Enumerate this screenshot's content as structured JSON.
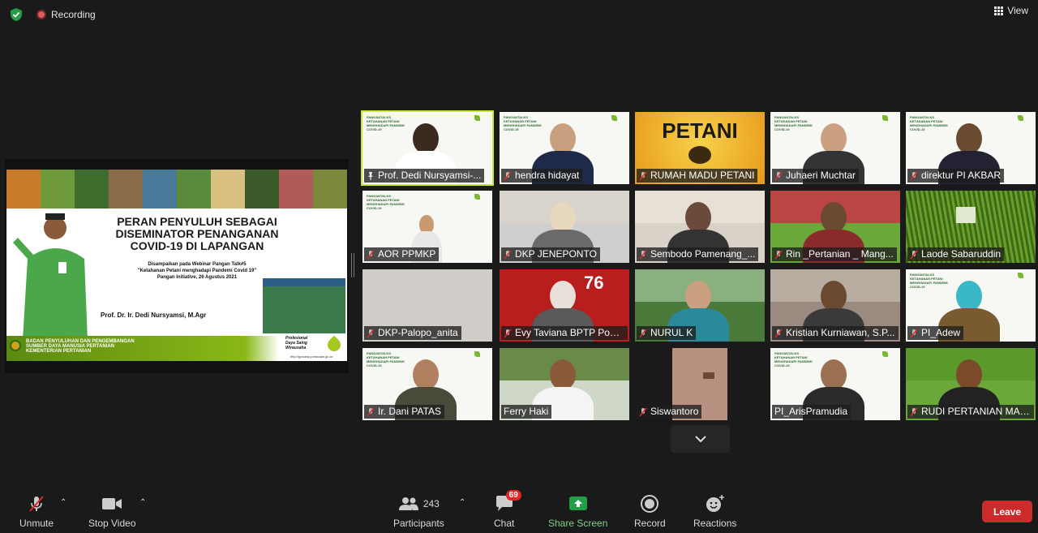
{
  "topbar": {
    "recording_label": "Recording",
    "view_label": "View"
  },
  "shared_slide": {
    "title": "PERAN PENYULUH SEBAGAI DISEMINATOR PENANGANAN COVID-19 DI LAPANGAN",
    "subtitle_1": "Disampaikan pada Webinar Pangan Talk#5",
    "subtitle_2": "\"Ketahanan Petani menghadapi Pandemi Covid 19\"",
    "subtitle_3": "Pangan Initiative, 26 Agustus 2021",
    "author": "Prof. Dr. Ir. Dedi Nursyamsi, M.Agr",
    "footer_1": "BADAN PENYULUHAN DAN PENGEMBANGAN",
    "footer_2": "SUMBER DAYA MANUSIA PERTANIAN",
    "footer_3": "KEMENTERIAN PERTANIAN",
    "motto_1": "Profesional",
    "motto_2": "Daya Saing",
    "motto_3": "Wirausaha",
    "url": "http://ppsdmp.pertanian.go.id"
  },
  "participants": [
    {
      "name": "Prof. Dedi Nursyamsi-...",
      "state": "pinned"
    },
    {
      "name": "hendra hidayat",
      "state": "muted"
    },
    {
      "name": "RUMAH MADU PETANI",
      "state": "muted",
      "banner": "PETANI"
    },
    {
      "name": "Juhaeri Muchtar",
      "state": "muted"
    },
    {
      "name": "direktur PI AKBAR",
      "state": "muted"
    },
    {
      "name": "AOR PPMKP",
      "state": "muted"
    },
    {
      "name": "DKP JENEPONTO",
      "state": "muted"
    },
    {
      "name": "Sembodo Pamenang_...",
      "state": "muted"
    },
    {
      "name": "Rin _Pertanian _ Mang...",
      "state": "muted"
    },
    {
      "name": "Laode Sabaruddin",
      "state": "muted"
    },
    {
      "name": "DKP-Palopo_anita",
      "state": "muted"
    },
    {
      "name": "Evy Taviana BPTP Ponti...",
      "state": "muted"
    },
    {
      "name": "NURUL K",
      "state": "muted"
    },
    {
      "name": "Kristian Kurniawan, S.P...",
      "state": "muted"
    },
    {
      "name": "PI_Adew",
      "state": "muted"
    },
    {
      "name": "Ir. Dani PATAS",
      "state": "muted"
    },
    {
      "name": "Ferry Haki",
      "state": "none"
    },
    {
      "name": "Siswantoro",
      "state": "muted"
    },
    {
      "name": "PI_ArisPramudia",
      "state": "none"
    },
    {
      "name": "RUDI PERTANIAN MAB...",
      "state": "muted"
    }
  ],
  "toolbar": {
    "unmute": "Unmute",
    "stop_video": "Stop Video",
    "participants": "Participants",
    "participants_count": "243",
    "chat": "Chat",
    "chat_badge": "69",
    "share_screen": "Share Screen",
    "record": "Record",
    "reactions": "Reactions",
    "leave": "Leave"
  },
  "colors": {
    "active_speaker": "#c8e830",
    "leave": "#cd2b2b",
    "share": "#23a047",
    "recording": "#e45a5a"
  }
}
